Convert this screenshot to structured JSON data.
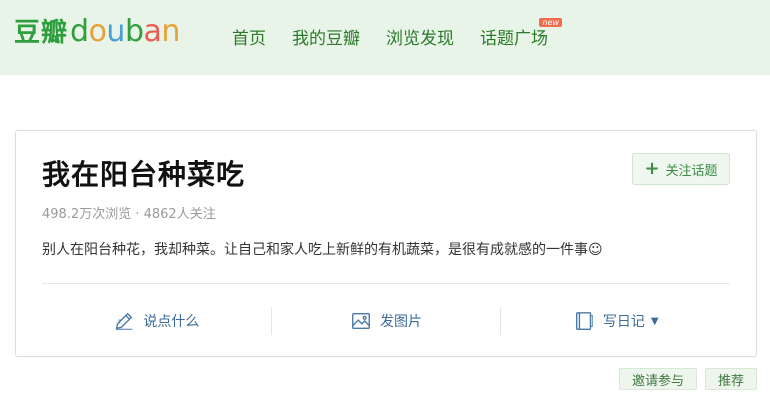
{
  "header": {
    "logo_cn": "豆瓣",
    "logo_en_letters": [
      "d",
      "o",
      "u",
      "b",
      "a",
      "n"
    ],
    "logo_en_colors": [
      "#2f9e3d",
      "#e6a13a",
      "#4a9fd8",
      "#2f9e3d",
      "#e85c57",
      "#e6a13a"
    ],
    "nav": [
      {
        "label": "首页",
        "key": "home"
      },
      {
        "label": "我的豆瓣",
        "key": "mine"
      },
      {
        "label": "浏览发现",
        "key": "explore"
      },
      {
        "label": "话题广场",
        "key": "topics",
        "badge": "new"
      }
    ]
  },
  "topic": {
    "title": "我在阳台种菜吃",
    "follow_label": "关注话题",
    "stats": "498.2万次浏览 · 4862人关注",
    "description": "别人在阳台种花，我却种菜。让自己和家人吃上新鲜的有机蔬菜，是很有成就感的一件事☺"
  },
  "actions": [
    {
      "label": "说点什么",
      "icon": "pen-icon"
    },
    {
      "label": "发图片",
      "icon": "image-icon"
    },
    {
      "label": "写日记",
      "icon": "book-icon",
      "caret": "▼"
    }
  ],
  "bottom": {
    "invite_label": "邀请参与",
    "recommend_label": "推荐"
  },
  "colors": {
    "header_bg": "#e9f4e9",
    "nav_text": "#2a7a2a",
    "action_text": "#3e6c9a",
    "badge": "#f36c4b"
  }
}
